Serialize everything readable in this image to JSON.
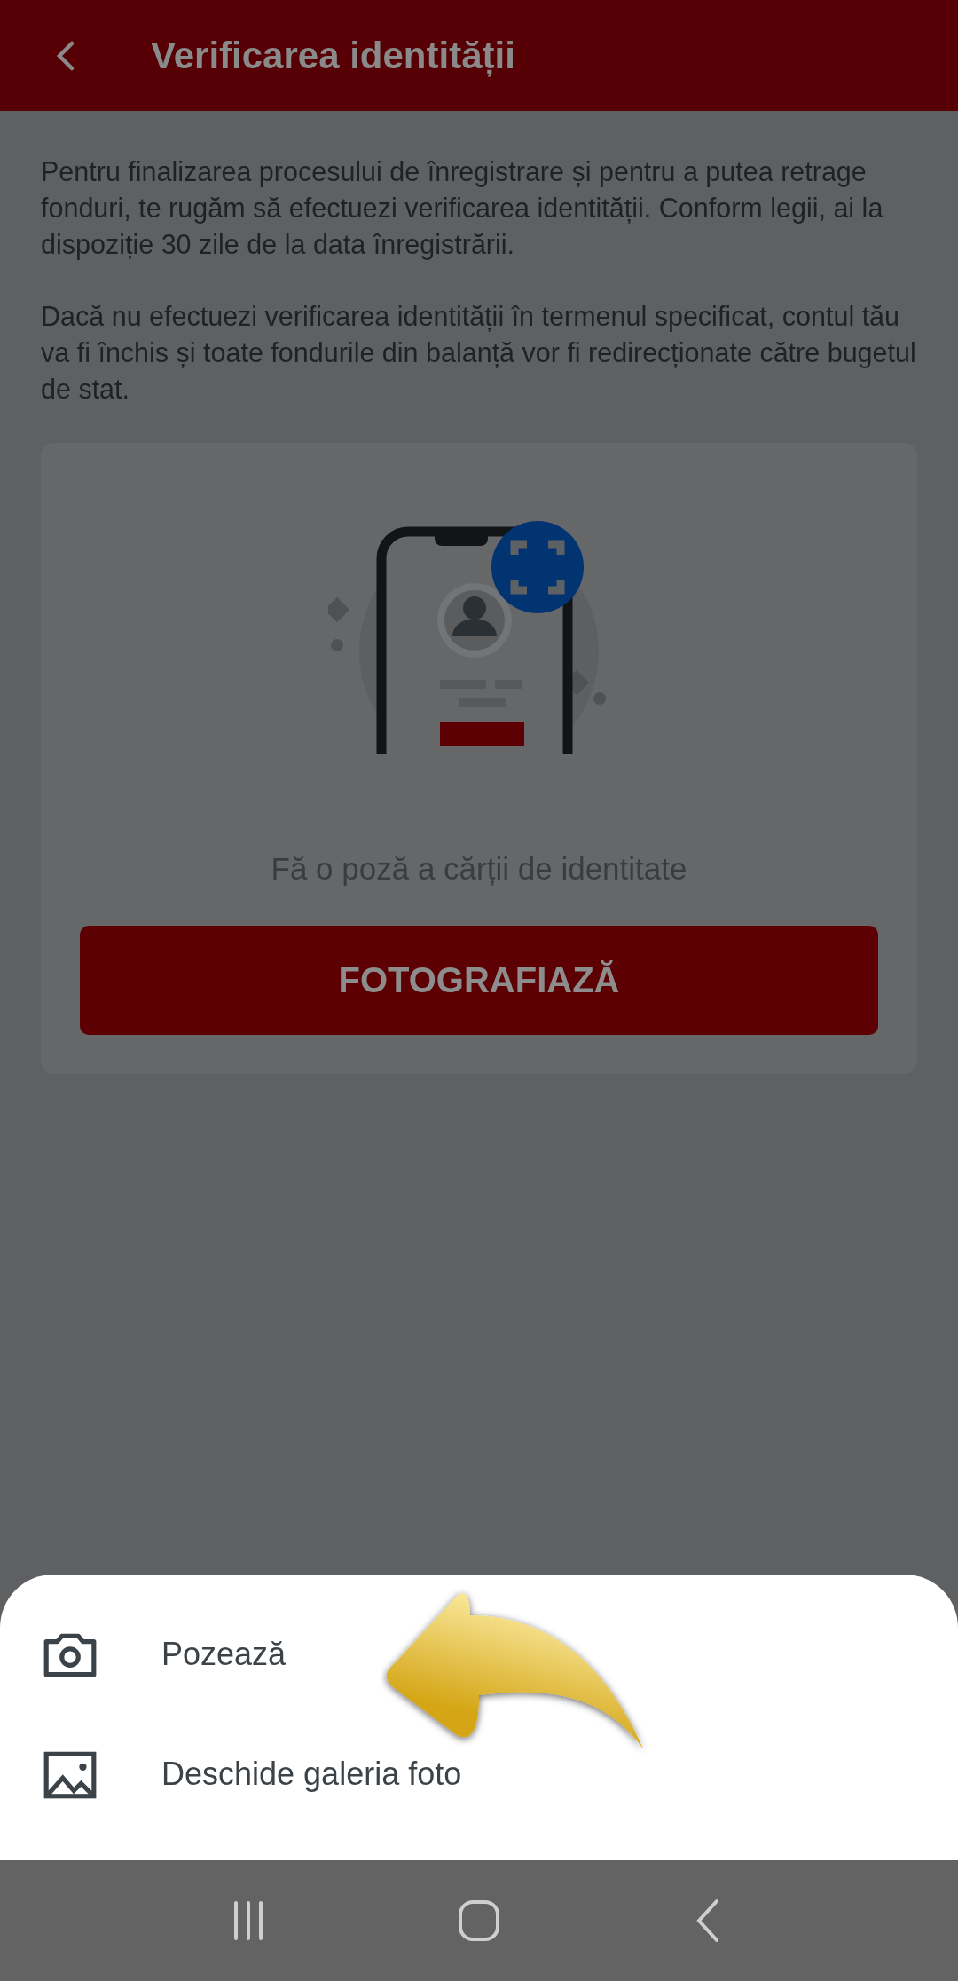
{
  "header": {
    "title": "Verificarea identității"
  },
  "paragraphs": [
    "Pentru finalizarea procesului de înregistrare și pentru a putea retrage fonduri, te rugăm să efectuezi verificarea identității. Conform legii, ai la dispoziție 30 zile de la data înregistrării.",
    "Dacă nu efectuezi verificarea identității în termenul specificat, contul tău va fi închis și toate fondurile din balanță vor fi redirecționate către bugetul de stat."
  ],
  "card": {
    "caption": "Fă o poză a cărții de identitate",
    "button": "FOTOGRAFIAZĂ"
  },
  "sheet": {
    "options": [
      {
        "kind": "camera",
        "label": "Pozează"
      },
      {
        "kind": "gallery",
        "label": "Deschide galeria foto"
      }
    ]
  }
}
